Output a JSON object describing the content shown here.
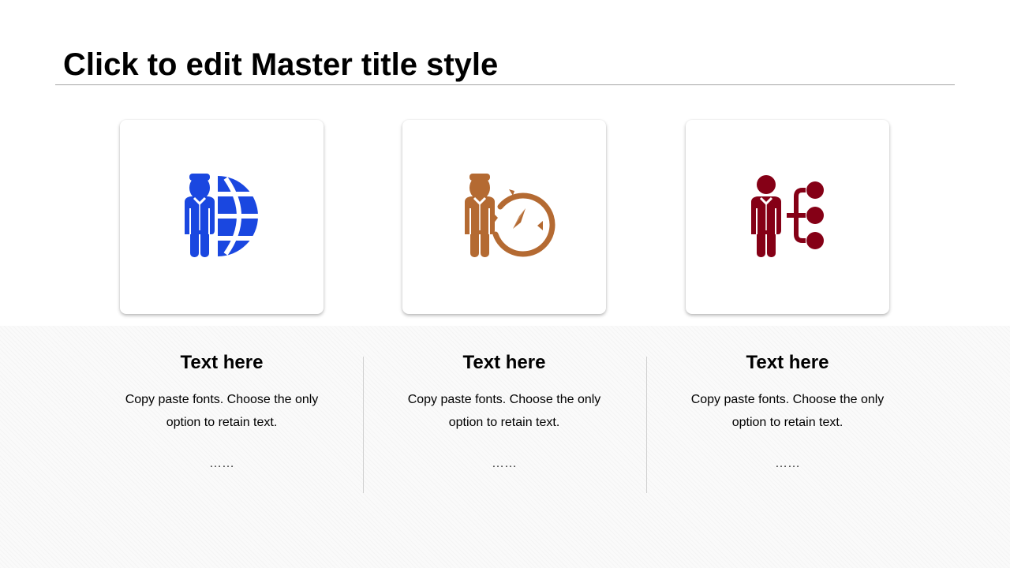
{
  "title": "Click to edit Master title style",
  "cards": [
    {
      "icon": "businessman-globe-icon",
      "color": "#1a47e0",
      "heading": "Text here",
      "body_line1": "Copy paste fonts. Choose the only",
      "body_line2": "option to retain text.",
      "ellipsis": "……"
    },
    {
      "icon": "businessman-compass-icon",
      "color": "#b46a32",
      "heading": "Text here",
      "body_line1": "Copy paste fonts. Choose the only",
      "body_line2": "option to retain text.",
      "ellipsis": "……"
    },
    {
      "icon": "businessman-hierarchy-icon",
      "color": "#850016",
      "heading": "Text here",
      "body_line1": "Copy paste fonts. Choose the only",
      "body_line2": "option to retain text.",
      "ellipsis": "……"
    }
  ]
}
